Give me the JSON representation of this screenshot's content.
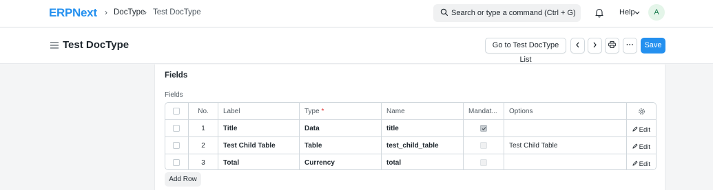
{
  "navbar": {
    "logo": "ERPNext",
    "breadcrumbs": [
      "DocType",
      "Test DocType"
    ],
    "search_placeholder": "Search or type a command (Ctrl + G)",
    "help_label": "Help",
    "avatar_initial": "A"
  },
  "page": {
    "title": "Test DocType",
    "go_to_list_label": "Go to Test DocType List",
    "more_label": "···",
    "save_label": "Save"
  },
  "section": {
    "title": "Fields",
    "field_label": "Fields"
  },
  "grid": {
    "columns": {
      "no": "No.",
      "label": "Label",
      "type": "Type",
      "type_required": "*",
      "name": "Name",
      "mandatory": "Mandat...",
      "options": "Options"
    },
    "edit_label": "Edit",
    "rows": [
      {
        "no": "1",
        "label": "Title",
        "type": "Data",
        "name": "title",
        "mandatory": true,
        "options": ""
      },
      {
        "no": "2",
        "label": "Test Child Table",
        "type": "Table",
        "name": "test_child_table",
        "mandatory": false,
        "options": "Test Child Table"
      },
      {
        "no": "3",
        "label": "Total",
        "type": "Currency",
        "name": "total",
        "mandatory": false,
        "options": ""
      }
    ],
    "add_row_label": "Add Row"
  },
  "colors": {
    "brand": "#2490ef",
    "primary_button": "#2490ef",
    "required_marker": "#e03636",
    "avatar_bg": "#e4f5e9",
    "avatar_text": "#16794c"
  }
}
